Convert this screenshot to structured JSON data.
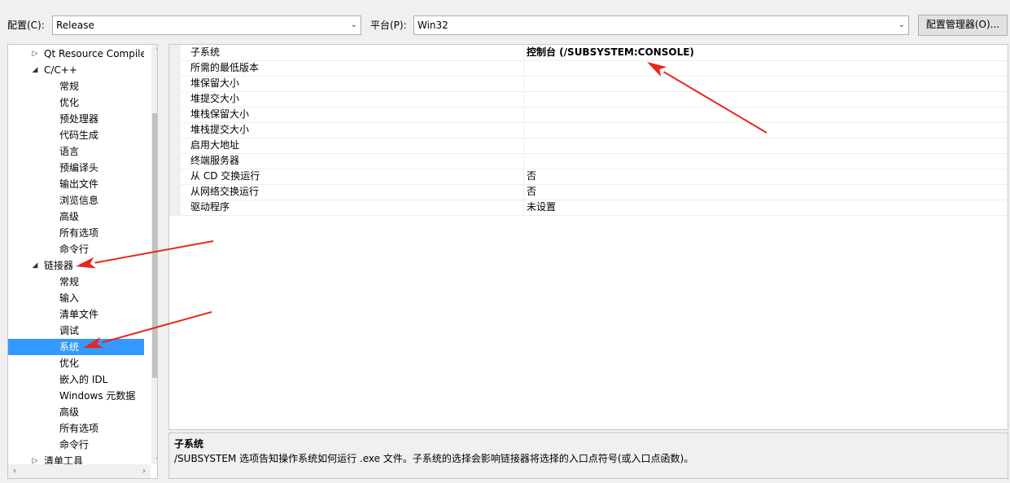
{
  "toolbar": {
    "config_label": "配置(C):",
    "config_value": "Release",
    "platform_label": "平台(P):",
    "platform_value": "Win32",
    "config_manager": "配置管理器(O)..."
  },
  "tree": {
    "items": [
      {
        "label": "Qt Resource Compile",
        "level": 1,
        "expander": "collapsed"
      },
      {
        "label": "C/C++",
        "level": 1,
        "expander": "expanded"
      },
      {
        "label": "常规",
        "level": 2
      },
      {
        "label": "优化",
        "level": 2
      },
      {
        "label": "预处理器",
        "level": 2
      },
      {
        "label": "代码生成",
        "level": 2
      },
      {
        "label": "语言",
        "level": 2
      },
      {
        "label": "预编译头",
        "level": 2
      },
      {
        "label": "输出文件",
        "level": 2
      },
      {
        "label": "浏览信息",
        "level": 2
      },
      {
        "label": "高级",
        "level": 2
      },
      {
        "label": "所有选项",
        "level": 2
      },
      {
        "label": "命令行",
        "level": 2
      },
      {
        "label": "链接器",
        "level": 1,
        "expander": "expanded"
      },
      {
        "label": "常规",
        "level": 2
      },
      {
        "label": "输入",
        "level": 2
      },
      {
        "label": "清单文件",
        "level": 2
      },
      {
        "label": "调试",
        "level": 2
      },
      {
        "label": "系统",
        "level": 2,
        "selected": true
      },
      {
        "label": "优化",
        "level": 2
      },
      {
        "label": "嵌入的 IDL",
        "level": 2
      },
      {
        "label": "Windows 元数据",
        "level": 2
      },
      {
        "label": "高级",
        "level": 2
      },
      {
        "label": "所有选项",
        "level": 2
      },
      {
        "label": "命令行",
        "level": 2
      },
      {
        "label": "清单工具",
        "level": 1,
        "expander": "collapsed"
      }
    ]
  },
  "grid": {
    "rows": [
      {
        "name": "子系统",
        "value": "控制台 (/SUBSYSTEM:CONSOLE)",
        "bold": true
      },
      {
        "name": "所需的最低版本",
        "value": ""
      },
      {
        "name": "堆保留大小",
        "value": ""
      },
      {
        "name": "堆提交大小",
        "value": ""
      },
      {
        "name": "堆栈保留大小",
        "value": ""
      },
      {
        "name": "堆栈提交大小",
        "value": ""
      },
      {
        "name": "启用大地址",
        "value": ""
      },
      {
        "name": "终端服务器",
        "value": ""
      },
      {
        "name": "从 CD 交换运行",
        "value": "否"
      },
      {
        "name": "从网络交换运行",
        "value": "否"
      },
      {
        "name": "驱动程序",
        "value": "未设置"
      }
    ]
  },
  "description": {
    "title": "子系统",
    "text": "/SUBSYSTEM 选项告知操作系统如何运行 .exe 文件。子系统的选择会影响链接器将选择的入口点符号(或入口点函数)。"
  },
  "colors": {
    "selection": "#3399ff",
    "annotation_arrow": "#e8261c"
  }
}
